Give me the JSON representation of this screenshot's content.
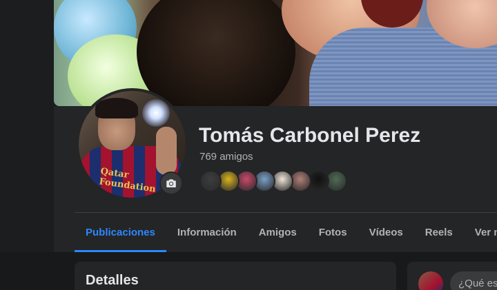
{
  "profile": {
    "name": "Tomás Carbonel Perez",
    "friend_count": "769 amigos",
    "jersey_text": "Qatar Foundation",
    "friend_avatar_colors": [
      "#3d3d3d",
      "#d9b31f",
      "#c9496a",
      "#7aa0c8",
      "#f0e6d8",
      "#b27f77",
      "#111111",
      "#4f6b55"
    ]
  },
  "tabs": [
    {
      "label": "Publicaciones",
      "active": true
    },
    {
      "label": "Información"
    },
    {
      "label": "Amigos"
    },
    {
      "label": "Fotos"
    },
    {
      "label": "Vídeos"
    },
    {
      "label": "Reels"
    },
    {
      "label": "Ver más"
    }
  ],
  "details": {
    "title": "Detalles"
  },
  "composer": {
    "placeholder": "¿Qué es"
  },
  "colors": {
    "accent": "#2d88ff",
    "background": "#18191a",
    "surface": "#242526",
    "secondary_text": "#b0b3b8"
  },
  "icons": {
    "camera": "camera-icon",
    "caret": "chevron-down-icon"
  }
}
